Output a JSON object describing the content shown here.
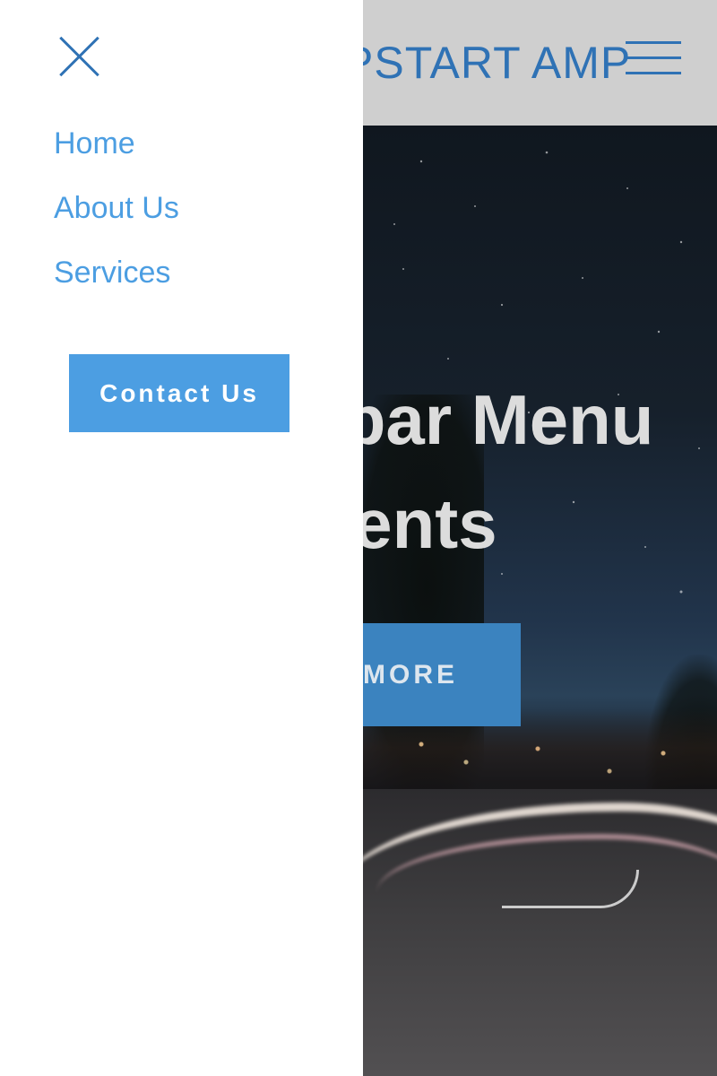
{
  "header": {
    "brand": "AMPSTART AMP"
  },
  "hero": {
    "title_line1": "Sidebar Menu",
    "title_line2": "Components",
    "button_label": "LEARN MORE"
  },
  "sidebar": {
    "nav_items": [
      {
        "label": "Home"
      },
      {
        "label": "About Us"
      },
      {
        "label": "Services"
      }
    ],
    "contact_label": "Contact Us"
  },
  "colors": {
    "accent": "#4c9ee2",
    "brand_blue": "#2f72b5",
    "header_bg": "#cfcfcf",
    "hero_button": "#3b83bf"
  },
  "icons": {
    "close": "close-icon",
    "menu": "hamburger-menu-icon"
  }
}
